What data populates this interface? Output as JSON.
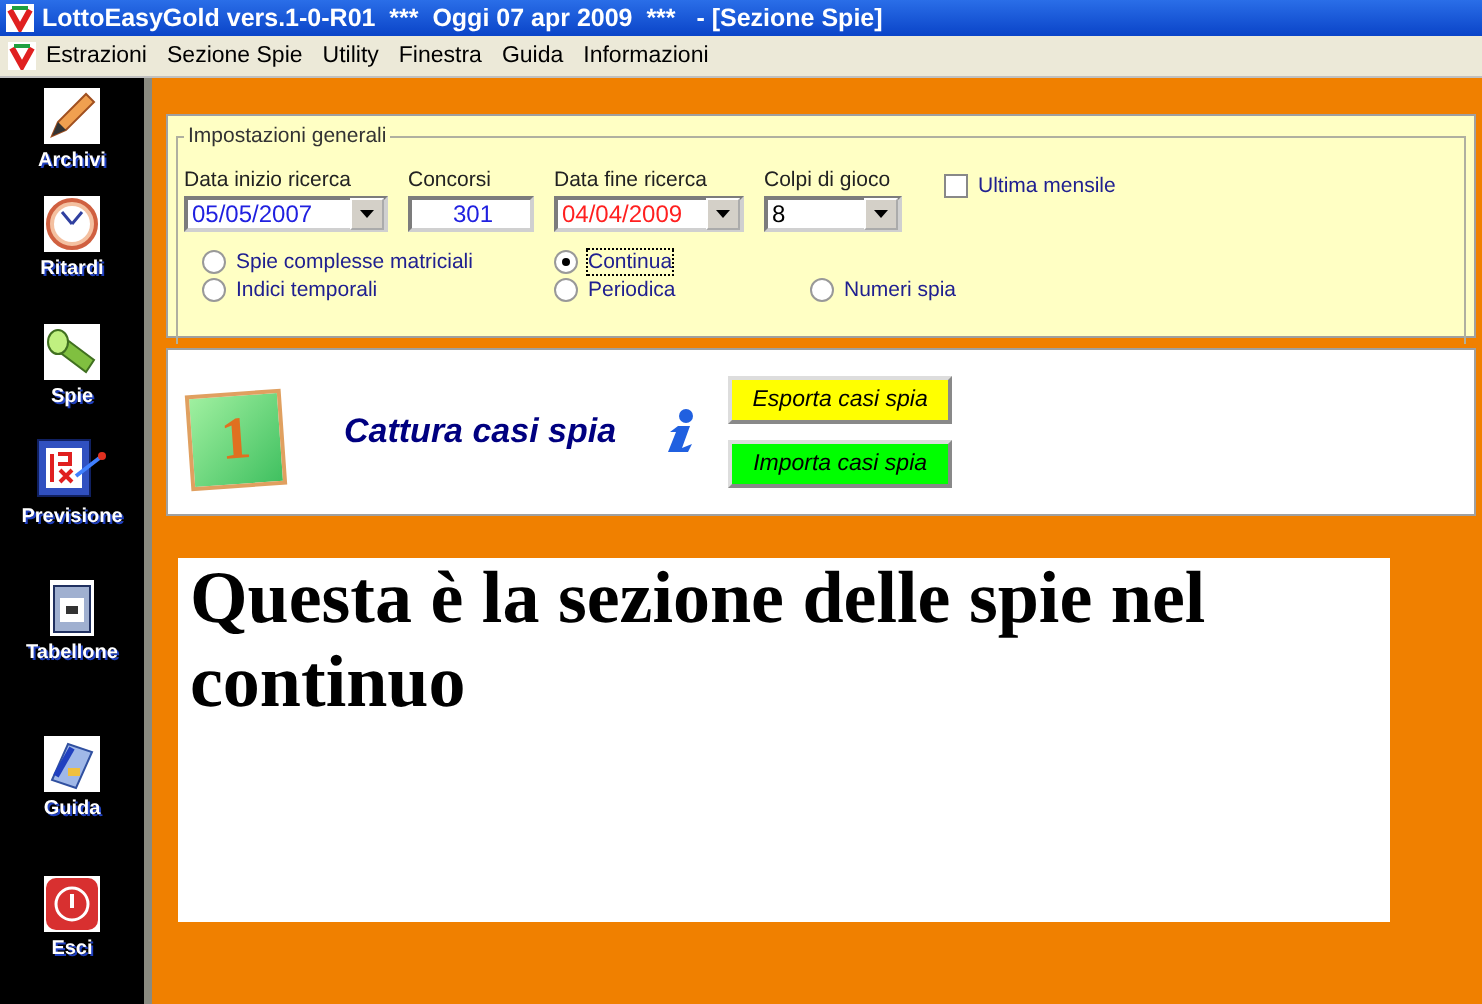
{
  "window": {
    "title": "LottoEasyGold vers.1-0-R01  ***  Oggi 07 apr 2009  ***   - [Sezione Spie]"
  },
  "menu": [
    "Estrazioni",
    "Sezione Spie",
    "Utility",
    "Finestra",
    "Guida",
    "Informazioni"
  ],
  "sidebar": [
    {
      "label": "Archivi",
      "kind": "pencil"
    },
    {
      "label": "Ritardi",
      "kind": "clock"
    },
    {
      "label": "Spie",
      "kind": "torch"
    },
    {
      "label": "Previsione",
      "kind": "board"
    },
    {
      "label": "Tabellone",
      "kind": "calendar"
    },
    {
      "label": "Guida",
      "kind": "book"
    },
    {
      "label": "Esci",
      "kind": "exit"
    }
  ],
  "settings": {
    "title": "Impostazioni generali",
    "fields": [
      {
        "label": "Data inizio ricerca",
        "value": "05/05/2007",
        "kind": "dropdown",
        "color": "#2020e0"
      },
      {
        "label": "Concorsi",
        "value": "301",
        "kind": "number",
        "color": "#2020e0"
      },
      {
        "label": "Data fine ricerca",
        "value": "04/04/2009",
        "kind": "dropdown",
        "color": "#ff2020"
      },
      {
        "label": "Colpi di gioco",
        "value": "8",
        "kind": "dropdown",
        "color": "#000000"
      }
    ],
    "checkbox": {
      "label": "Ultima mensile",
      "checked": false
    },
    "radios": [
      [
        {
          "label": "Spie complesse matriciali",
          "selected": false
        },
        {
          "label": "Continua",
          "selected": true
        }
      ],
      [
        {
          "label": "Indici temporali",
          "selected": false
        },
        {
          "label": "Periodica",
          "selected": false
        },
        {
          "label": "Numeri spia",
          "selected": false
        }
      ]
    ]
  },
  "capture": {
    "step": "1",
    "title": "Cattura casi spia",
    "buttons": [
      {
        "label": "Esporta casi spia",
        "color": "#ffff00"
      },
      {
        "label": "Importa casi spia",
        "color": "#00ff00"
      }
    ]
  },
  "message": "Questa è la sezione delle spie nel continuo"
}
